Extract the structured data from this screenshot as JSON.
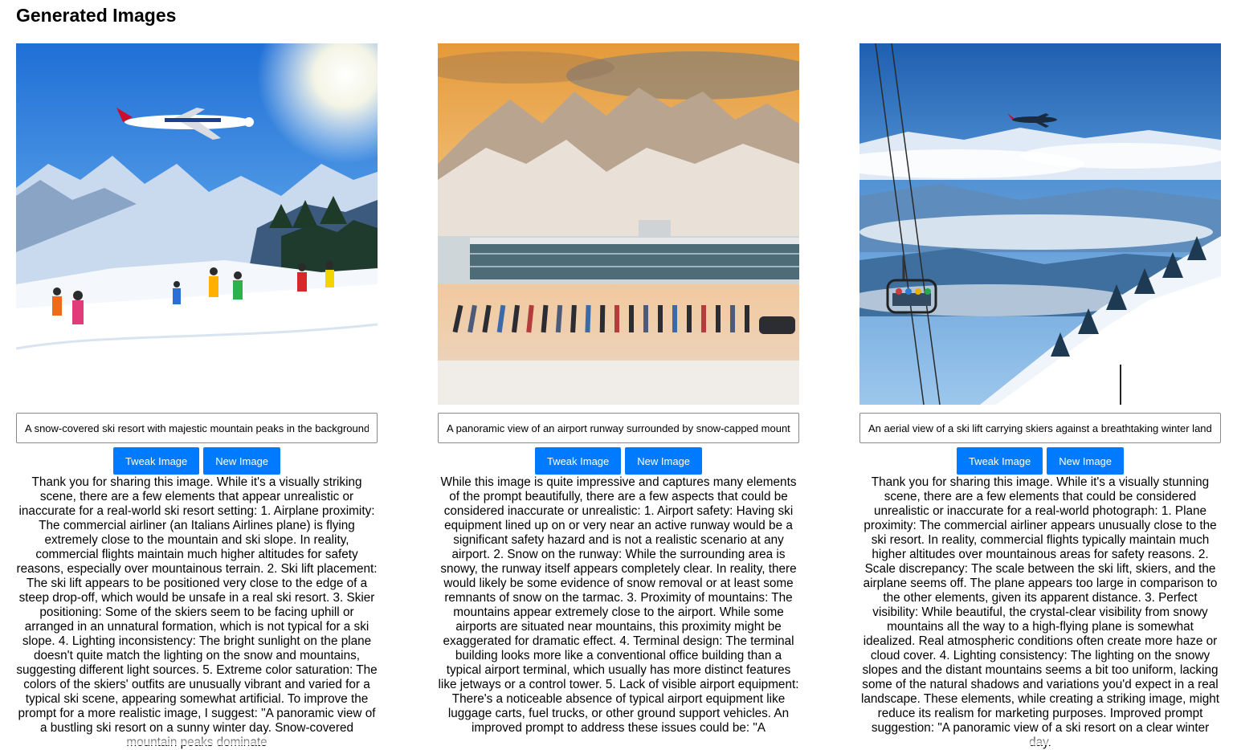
{
  "page": {
    "title": "Generated Images"
  },
  "buttons": {
    "tweak_label": "Tweak Image",
    "new_label": "New Image"
  },
  "colors": {
    "button_bg": "#007bff",
    "button_text": "#ffffff"
  },
  "cards": [
    {
      "image_description": "ski resort slope with skiers and commercial airplane overhead",
      "prompt": "A snow-covered ski resort with majestic mountain peaks in the background, skiers on the slope and a commercial airplane in the sky",
      "feedback": "Thank you for sharing this image. While it's a visually striking scene, there are a few elements that appear unrealistic or inaccurate for a real-world ski resort setting: 1. Airplane proximity: The commercial airliner (an Italians Airlines plane) is flying extremely close to the mountain and ski slope. In reality, commercial flights maintain much higher altitudes for safety reasons, especially over mountainous terrain. 2. Ski lift placement: The ski lift appears to be positioned very close to the edge of a steep drop-off, which would be unsafe in a real ski resort. 3. Skier positioning: Some of the skiers seem to be facing uphill or arranged in an unnatural formation, which is not typical for a ski slope. 4. Lighting inconsistency: The bright sunlight on the plane doesn't quite match the lighting on the snow and mountains, suggesting different light sources. 5. Extreme color saturation: The colors of the skiers' outfits are unusually vibrant and varied for a typical ski scene, appearing somewhat artificial. To improve the prompt for a more realistic image, I suggest: \"A panoramic view of a bustling ski resort on a sunny winter day. Snow-covered mountain peaks dominate"
    },
    {
      "image_description": "airport terminal with skis lined up on snowy runway, mountains behind",
      "prompt": "A panoramic view of an airport runway surrounded by snow-capped mountains with a terminal building and skis lined up",
      "feedback": "While this image is quite impressive and captures many elements of the prompt beautifully, there are a few aspects that could be considered inaccurate or unrealistic: 1. Airport safety: Having ski equipment lined up on or very near an active runway would be a significant safety hazard and is not a realistic scenario at any airport. 2. Snow on the runway: While the surrounding area is snowy, the runway itself appears completely clear. In reality, there would likely be some evidence of snow removal or at least some remnants of snow on the tarmac. 3. Proximity of mountains: The mountains appear extremely close to the airport. While some airports are situated near mountains, this proximity might be exaggerated for dramatic effect. 4. Terminal design: The terminal building looks more like a conventional office building than a typical airport terminal, which usually has more distinct features like jetways or a control tower. 5. Lack of visible airport equipment: There's a noticeable absence of typical airport equipment like luggage carts, fuel trucks, or other ground support vehicles. An improved prompt to address these issues could be: \"A"
    },
    {
      "image_description": "aerial view of ski lift gondola over snowy valley with airplane",
      "prompt": "An aerial view of a ski lift carrying skiers against a breathtaking winter landscape with a plane flying in the distance",
      "feedback": "Thank you for sharing this image. While it's a visually stunning scene, there are a few elements that could be considered unrealistic or inaccurate for a real-world photograph: 1. Plane proximity: The commercial airliner appears unusually close to the ski resort. In reality, commercial flights typically maintain much higher altitudes over mountainous areas for safety reasons. 2. Scale discrepancy: The scale between the ski lift, skiers, and the airplane seems off. The plane appears too large in comparison to the other elements, given its apparent distance. 3. Perfect visibility: While beautiful, the crystal-clear visibility from snowy mountains all the way to a high-flying plane is somewhat idealized. Real atmospheric conditions often create more haze or cloud cover. 4. Lighting consistency: The lighting on the snowy slopes and the distant mountains seems a bit too uniform, lacking some of the natural shadows and variations you'd expect in a real landscape. These elements, while creating a striking image, might reduce its realism for marketing purposes. Improved prompt suggestion: \"A panoramic view of a ski resort on a clear winter day."
    }
  ]
}
